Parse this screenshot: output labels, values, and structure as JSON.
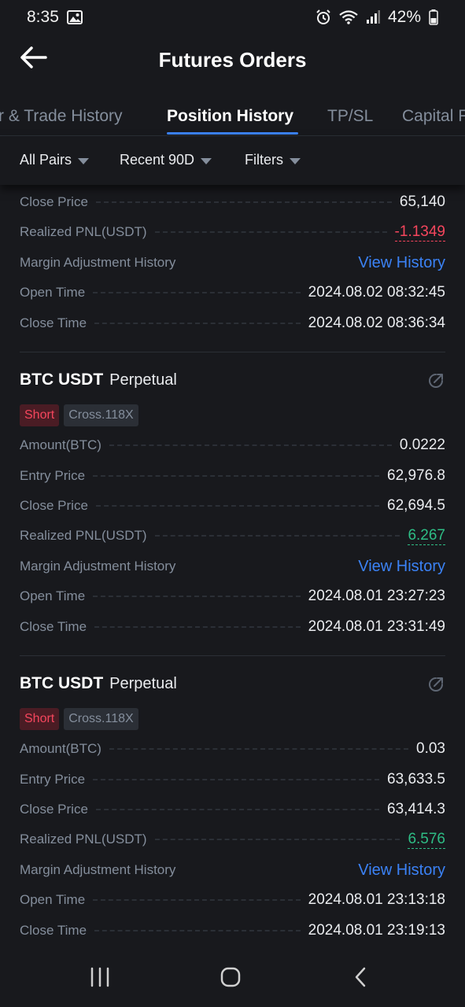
{
  "status_bar": {
    "time": "8:35",
    "battery": "42%"
  },
  "header": {
    "title": "Futures Orders"
  },
  "tabs": [
    {
      "label": "r & Trade History"
    },
    {
      "label": "Position History"
    },
    {
      "label": "TP/SL"
    },
    {
      "label": "Capital F"
    }
  ],
  "filters": {
    "pairs": "All Pairs",
    "period": "Recent 90D",
    "filters": "Filters"
  },
  "top_partial": {
    "rows": [
      {
        "label": "Close Price",
        "value": "65,140"
      },
      {
        "label": "Realized PNL(USDT)",
        "value": "-1.1349"
      },
      {
        "label": "Margin Adjustment History",
        "value": "View History"
      },
      {
        "label": "Open Time",
        "value": "2024.08.02 08:32:45"
      },
      {
        "label": "Close Time",
        "value": "2024.08.02 08:36:34"
      }
    ]
  },
  "positions": [
    {
      "pair": "BTC USDT",
      "type": "Perpetual",
      "side": "Short",
      "margin": "Cross.118X",
      "rows": [
        {
          "label": "Amount(BTC)",
          "value": "0.0222"
        },
        {
          "label": "Entry Price",
          "value": "62,976.8"
        },
        {
          "label": "Close Price",
          "value": "62,694.5"
        },
        {
          "label": "Realized PNL(USDT)",
          "value": "6.267"
        },
        {
          "label": "Margin Adjustment History",
          "value": "View History"
        },
        {
          "label": "Open Time",
          "value": "2024.08.01 23:27:23"
        },
        {
          "label": "Close Time",
          "value": "2024.08.01 23:31:49"
        }
      ]
    },
    {
      "pair": "BTC USDT",
      "type": "Perpetual",
      "side": "Short",
      "margin": "Cross.118X",
      "rows": [
        {
          "label": "Amount(BTC)",
          "value": "0.03"
        },
        {
          "label": "Entry Price",
          "value": "63,633.5"
        },
        {
          "label": "Close Price",
          "value": "63,414.3"
        },
        {
          "label": "Realized PNL(USDT)",
          "value": "6.576"
        },
        {
          "label": "Margin Adjustment History",
          "value": "View History"
        },
        {
          "label": "Open Time",
          "value": "2024.08.01 23:13:18"
        },
        {
          "label": "Close Time",
          "value": "2024.08.01 23:19:13"
        }
      ]
    }
  ],
  "colors": {
    "background": "#18191d",
    "accent_blue": "#3b82f6",
    "loss_red": "#f6465d",
    "profit_green": "#2ebd85",
    "muted_text": "#848e9c"
  },
  "icons": {
    "back": "arrow-left-icon",
    "share": "share-icon",
    "nav_recents": "recents-icon",
    "nav_home": "home-icon",
    "nav_back": "chevron-left-icon"
  }
}
